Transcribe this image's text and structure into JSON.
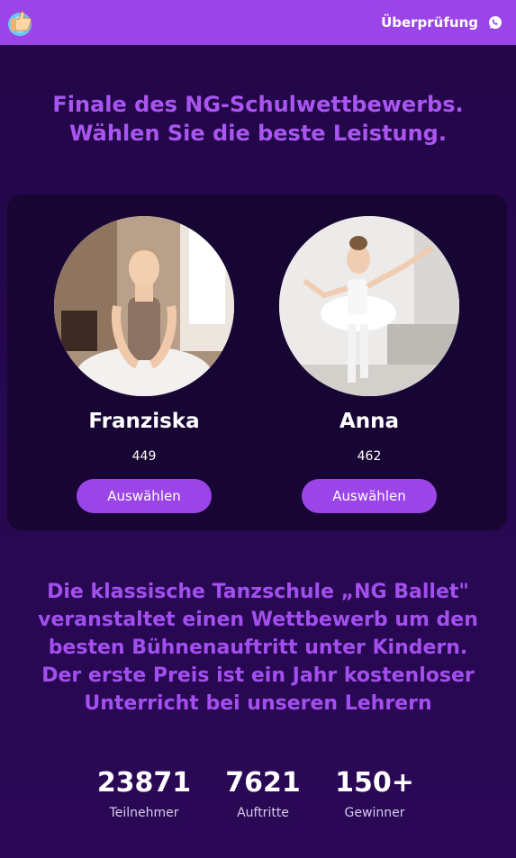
{
  "header": {
    "review_label": "Überprüfung",
    "whatsapp_icon": "whatsapp-icon",
    "logo_icon": "thumbs-up-logo-icon",
    "bg_color": "#9b45e8"
  },
  "headline": {
    "line1": "Finale des NG-Schulwettbewerbs.",
    "line2": "Wählen Sie die beste Leistung."
  },
  "contestants": [
    {
      "name": "Franziska",
      "votes": "449",
      "button_label": "Auswählen"
    },
    {
      "name": "Anna",
      "votes": "462",
      "button_label": "Auswählen"
    }
  ],
  "description": {
    "line1": "Die klassische Tanzschule „NG Ballet\"",
    "line2": "veranstaltet einen Wettbewerb um den",
    "line3": "besten Bühnenauftritt unter Kindern.",
    "line4": "Der erste Preis ist ein Jahr kostenloser",
    "line5": "Unterricht bei unseren Lehrern"
  },
  "stats": [
    {
      "value": "23871",
      "label": "Teilnehmer"
    },
    {
      "value": "7621",
      "label": "Auftritte"
    },
    {
      "value": "150+",
      "label": "Gewinner"
    }
  ],
  "colors": {
    "accent": "#9b45e8",
    "headline_text": "#a955f0",
    "background": "#230748",
    "card": "#170534"
  }
}
